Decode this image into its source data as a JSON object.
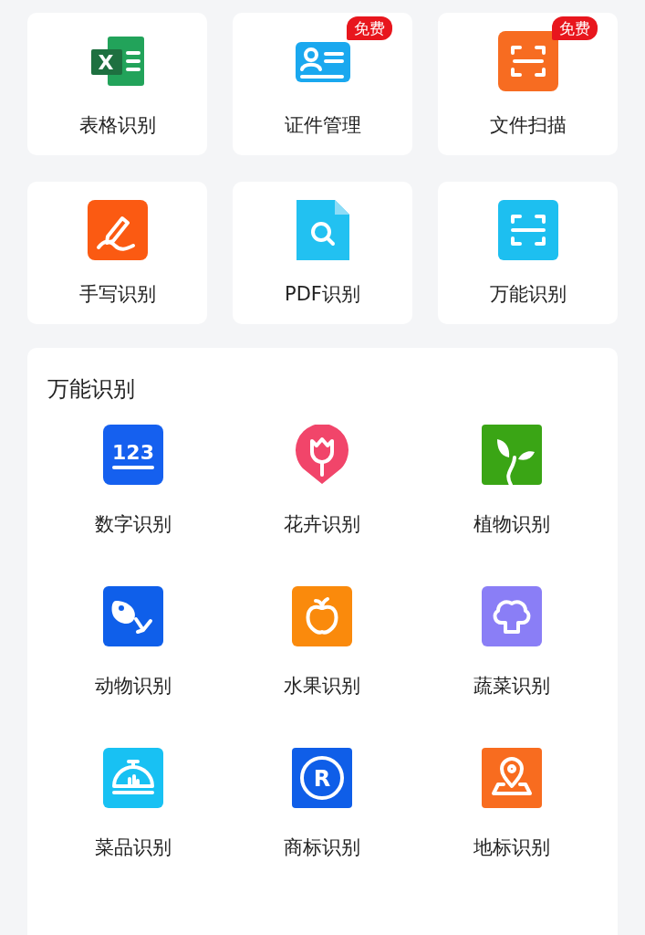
{
  "tools": [
    {
      "label": "表格识别",
      "kind": "spreadsheet",
      "glyph": "X"
    },
    {
      "label": "证件管理",
      "kind": "idcard",
      "badge": "免费"
    },
    {
      "label": "文件扫描",
      "kind": "scanorange",
      "badge": "免费"
    },
    {
      "label": "手写识别",
      "kind": "handwriting"
    },
    {
      "label": "PDF识别",
      "kind": "pdf"
    },
    {
      "label": "万能识别",
      "kind": "scancyan"
    }
  ],
  "panel": {
    "title": "万能识别",
    "items": [
      {
        "label": "数字识别",
        "kind": "number",
        "glyph": "123"
      },
      {
        "label": "花卉识别",
        "kind": "flower"
      },
      {
        "label": "植物识别",
        "kind": "plant"
      },
      {
        "label": "动物识别",
        "kind": "animal"
      },
      {
        "label": "水果识别",
        "kind": "fruit"
      },
      {
        "label": "蔬菜识别",
        "kind": "vegetable"
      },
      {
        "label": "菜品识别",
        "kind": "dish"
      },
      {
        "label": "商标识别",
        "kind": "trademark",
        "glyph": "R"
      },
      {
        "label": "地标识别",
        "kind": "landmark"
      }
    ]
  }
}
